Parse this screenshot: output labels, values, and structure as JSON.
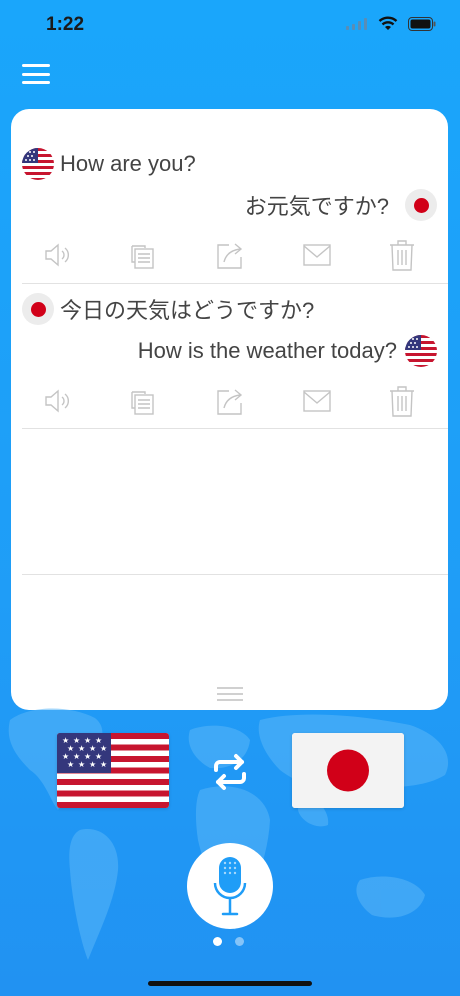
{
  "status": {
    "time": "1:22"
  },
  "conversation": [
    {
      "source_text": "How are you?",
      "source_lang": "en",
      "target_text": "お元気ですか?",
      "target_lang": "ja"
    },
    {
      "source_text": "今日の天気はどうですか?",
      "source_lang": "ja",
      "target_text": "How is the weather today?",
      "target_lang": "en"
    }
  ],
  "actions": [
    "speaker-icon",
    "copy-icon",
    "share-icon",
    "mail-icon",
    "trash-icon"
  ],
  "languages": {
    "left": "English (US)",
    "right": "Japanese"
  },
  "pager": {
    "count": 2,
    "active": 1
  },
  "colors": {
    "background": "#1f9df7",
    "card": "#ffffff",
    "text": "#444444",
    "icon": "#c4c4c4",
    "japan_red": "#d10018",
    "us_red": "#c7152f",
    "us_blue": "#34377c"
  }
}
